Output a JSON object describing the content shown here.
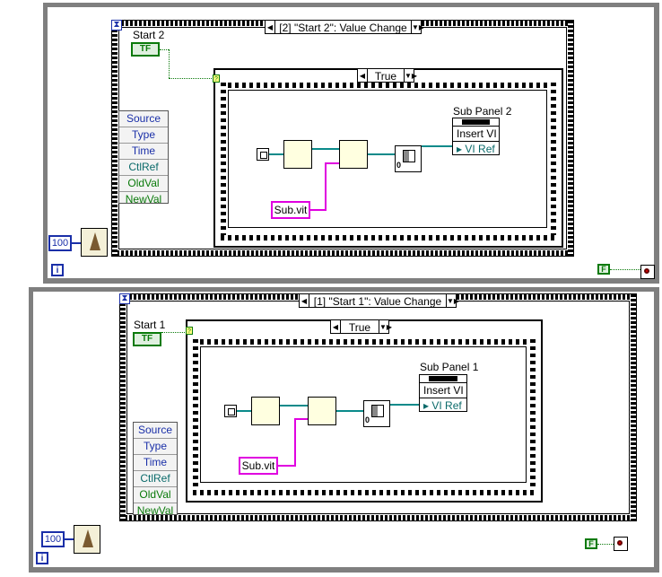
{
  "loops": [
    {
      "event_case": "[2] \"Start 2\": Value Change",
      "control_label": "Start 2",
      "case_value": "True",
      "subpanel_label": "Sub Panel 2",
      "invoke_method": "Insert VI",
      "invoke_param": "VI Ref",
      "string_const": "Sub.vit",
      "wait_ms": "100",
      "iteration": "i",
      "stop_const": "F",
      "event_data": [
        "Source",
        "Type",
        "Time",
        "CtlRef",
        "OldVal",
        "NewVal"
      ],
      "tf_label": "TF"
    },
    {
      "event_case": "[1] \"Start 1\": Value Change",
      "control_label": "Start 1",
      "case_value": "True",
      "subpanel_label": "Sub Panel 1",
      "invoke_method": "Insert VI",
      "invoke_param": "VI Ref",
      "string_const": "Sub.vit",
      "wait_ms": "100",
      "iteration": "i",
      "stop_const": "F",
      "event_data": [
        "Source",
        "Type",
        "Time",
        "CtlRef",
        "OldVal",
        "NewVal"
      ],
      "tf_label": "TF"
    }
  ],
  "colors": {
    "loop_border": "#7f7f7f",
    "boolean_wire": "#0a7a0a",
    "string_wire": "#e000e0",
    "ref_wire": "#0a8a8a",
    "numeric": "#1a2fa8"
  }
}
